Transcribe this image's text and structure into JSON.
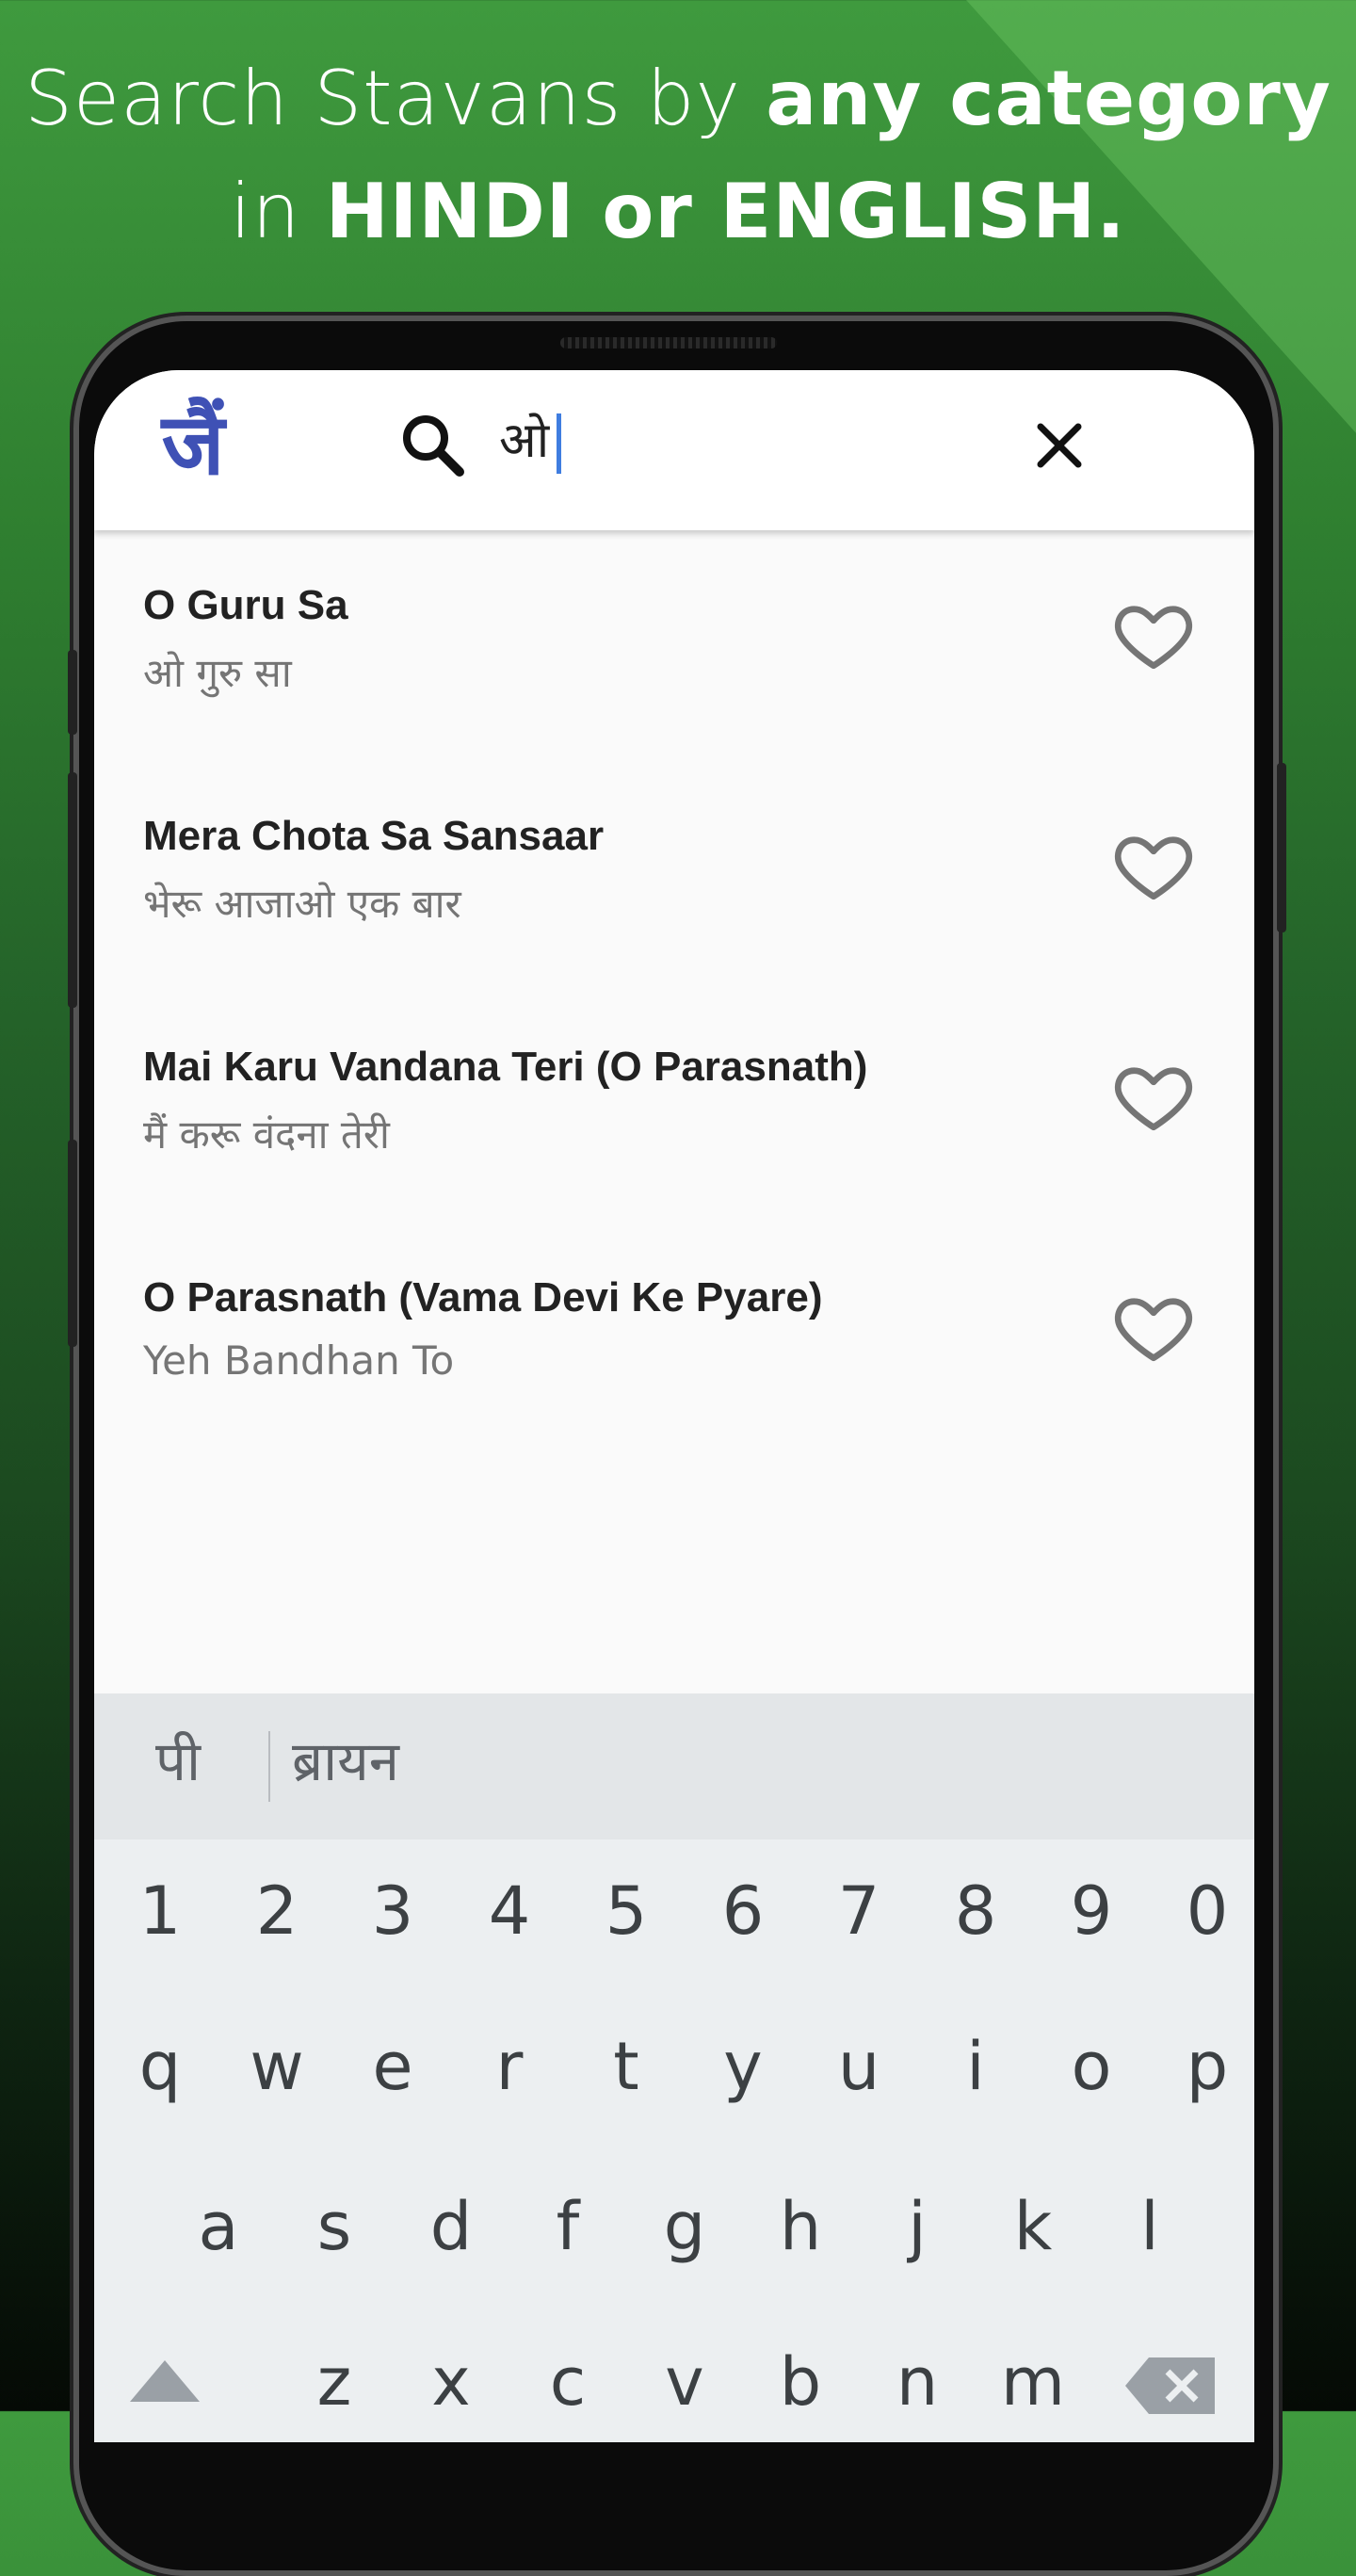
{
  "headline": {
    "line1_plain": "Search Stavans by ",
    "line1_bold": "any category",
    "line2_plain": "in ",
    "line2_bold": "HINDI or ENGLISH."
  },
  "appbar": {
    "logo_glyph": "जैं",
    "search_value": "ओ",
    "search_icon": "search-icon",
    "close_icon": "close-icon"
  },
  "results": [
    {
      "title": "O Guru Sa",
      "subtitle": "ओ गुरु सा",
      "favorite": false
    },
    {
      "title": "Mera Chota Sa Sansaar",
      "subtitle": "भेरू आजाओ एक बार",
      "favorite": false
    },
    {
      "title": "Mai Karu Vandana Teri (O Parasnath)",
      "subtitle": "मैं करू वंदना तेरी",
      "favorite": false
    },
    {
      "title": "O Parasnath (Vama Devi Ke Pyare)",
      "subtitle": "Yeh Bandhan To",
      "favorite": false
    }
  ],
  "suggestions": [
    "पी",
    "ब्रायन"
  ],
  "keyboard": {
    "row_numbers": [
      "1",
      "2",
      "3",
      "4",
      "5",
      "6",
      "7",
      "8",
      "9",
      "0"
    ],
    "row_q": [
      "q",
      "w",
      "e",
      "r",
      "t",
      "y",
      "u",
      "i",
      "o",
      "p"
    ],
    "row_a": [
      "a",
      "s",
      "d",
      "f",
      "g",
      "h",
      "j",
      "k",
      "l"
    ],
    "row_z": [
      "z",
      "x",
      "c",
      "v",
      "b",
      "n",
      "m"
    ]
  },
  "colors": {
    "accent": "#3f51b5",
    "caret": "#3f7de0",
    "background_green": "#3f9a3e"
  }
}
